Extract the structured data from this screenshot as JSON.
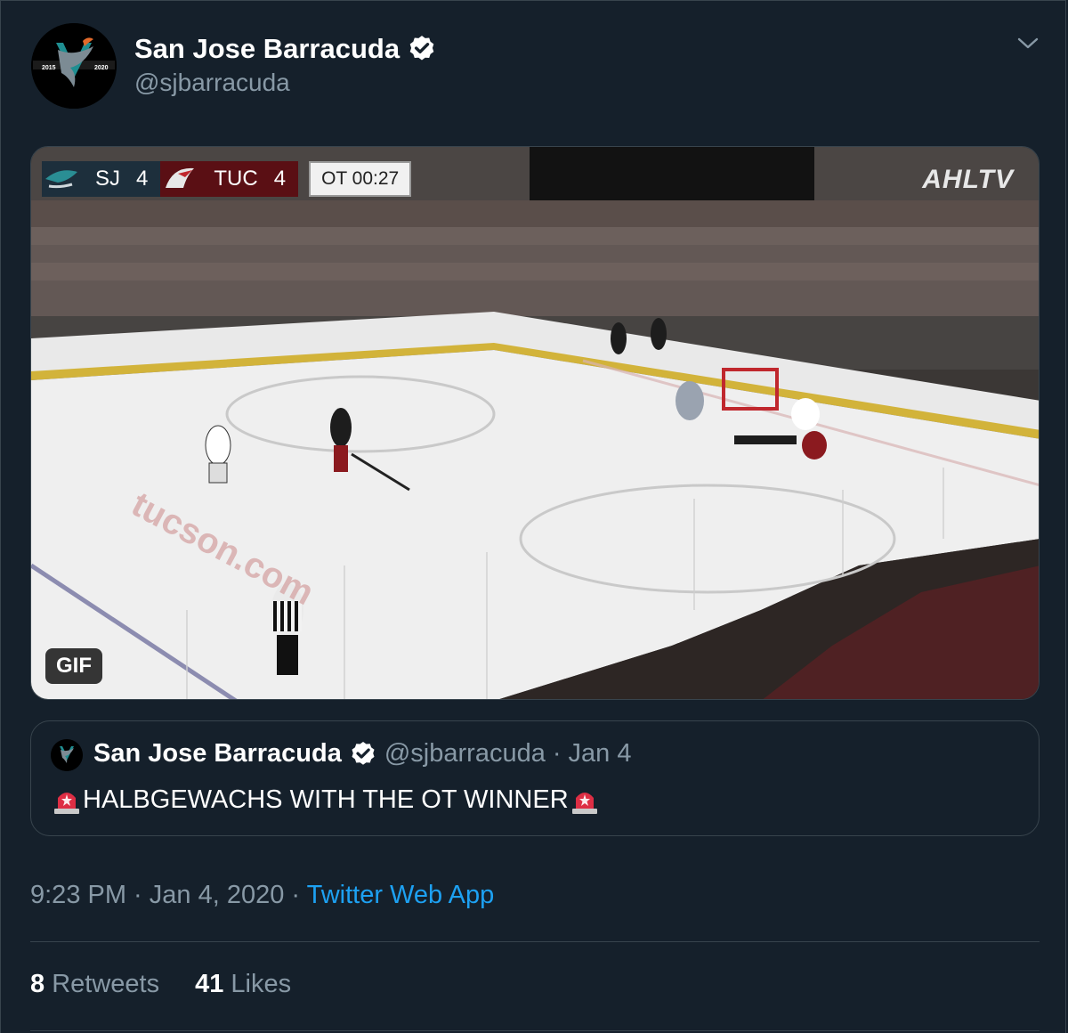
{
  "tweet": {
    "author_name": "San Jose Barracuda",
    "author_handle": "@sjbarracuda",
    "avatar_years": [
      "2015",
      "2020"
    ],
    "media": {
      "badge": "GIF",
      "scorebug": {
        "team1": "SJ",
        "score1": "4",
        "team2": "TUC",
        "score2": "4",
        "clock": "OT 00:27"
      },
      "broadcaster": "AHLTV"
    },
    "timestamp": "9:23 PM · Jan 4, 2020 · ",
    "source": "Twitter Web App",
    "retweets_count": "8",
    "retweets_label": "Retweets",
    "likes_count": "41",
    "likes_label": "Likes"
  },
  "quoted": {
    "author_name": "San Jose Barracuda",
    "author_handle": "@sjbarracuda",
    "date": "· Jan 4",
    "text": "HALBGEWACHS WITH THE OT WINNER"
  },
  "colors": {
    "background": "#15202b",
    "border": "#38444d",
    "secondary_text": "#8899a6",
    "link": "#1da1f2"
  }
}
